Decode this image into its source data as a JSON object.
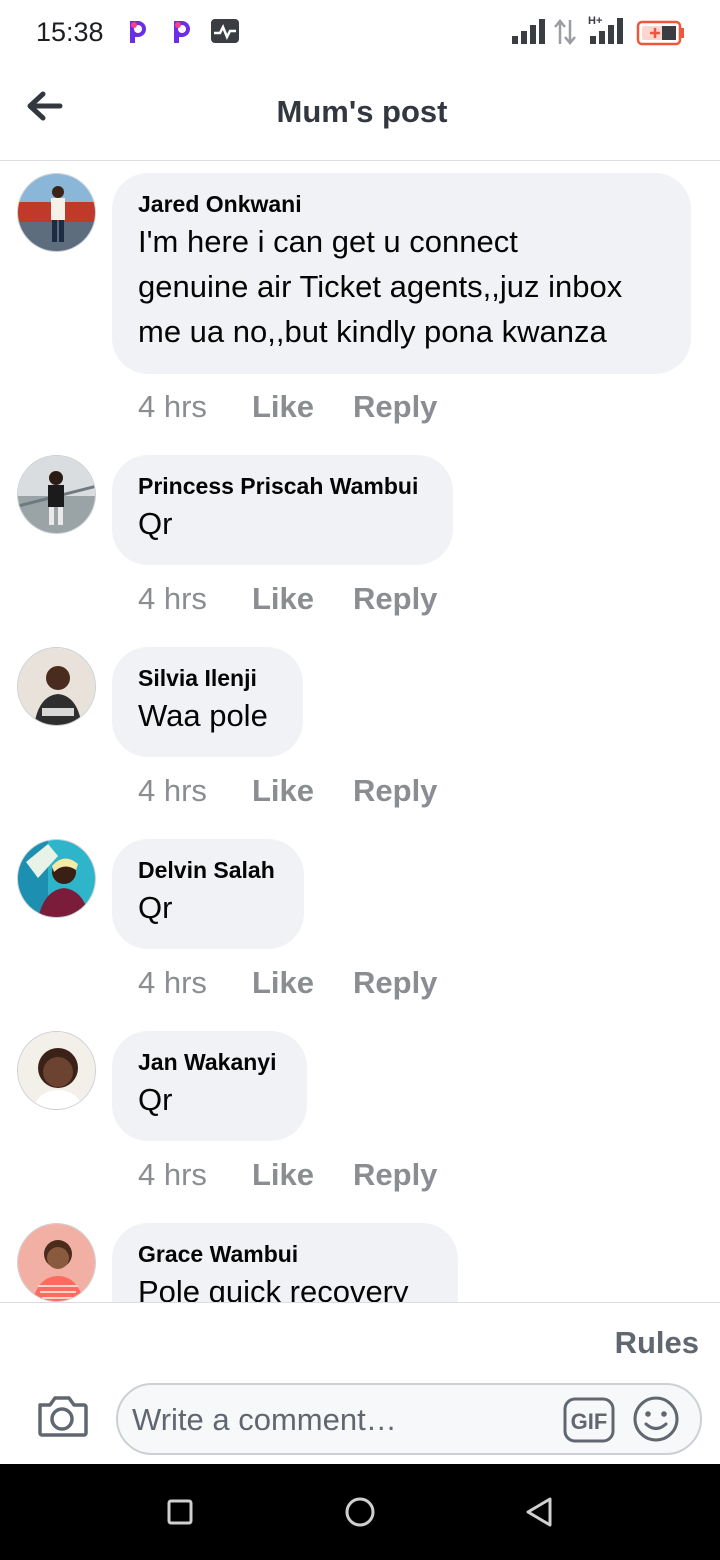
{
  "status_bar": {
    "time": "15:38",
    "icons": [
      "pocket-app-icon",
      "pocket-app-icon",
      "activity-monitor-icon",
      "signal-icon",
      "data-transfer-icon",
      "hplus-signal-icon",
      "battery-charging-icon"
    ],
    "network_label": "H+"
  },
  "header": {
    "title": "Mum's post",
    "back_icon": "arrow-left-icon"
  },
  "comments": [
    {
      "name": "Jared Onkwani",
      "text_lines": [
        "I'm here i can get u connect",
        "genuine air Ticket agents,,juz inbox",
        "me ua no,,but kindly pona kwanza"
      ],
      "time": "4 hrs",
      "like": "Like",
      "reply": "Reply"
    },
    {
      "name": "Princess Priscah Wambui",
      "text_lines": [
        "Qr"
      ],
      "time": "4 hrs",
      "like": "Like",
      "reply": "Reply"
    },
    {
      "name": "Silvia Ilenji",
      "text_lines": [
        "Waa pole"
      ],
      "time": "4 hrs",
      "like": "Like",
      "reply": "Reply"
    },
    {
      "name": "Delvin Salah",
      "text_lines": [
        "Qr"
      ],
      "time": "4 hrs",
      "like": "Like",
      "reply": "Reply"
    },
    {
      "name": "Jan Wakanyi",
      "text_lines": [
        "Qr"
      ],
      "time": "4 hrs",
      "like": "Like",
      "reply": "Reply"
    },
    {
      "name": "Grace Wambui",
      "text_lines": [
        "Pole quick recovery"
      ],
      "time": "",
      "like": "",
      "reply": ""
    }
  ],
  "composer": {
    "rules_label": "Rules",
    "placeholder": "Write a comment…",
    "gif_label": "GIF",
    "icons": [
      "camera-icon",
      "gif-icon",
      "emoji-icon"
    ]
  },
  "nav_bar": {
    "icons": [
      "recent-apps-icon",
      "home-icon",
      "back-triangle-icon"
    ]
  },
  "colors": {
    "bubble": "#f0f2f5",
    "meta_text": "#8a8d91",
    "header_text": "#333840",
    "battery_accent": "#f0563b"
  }
}
